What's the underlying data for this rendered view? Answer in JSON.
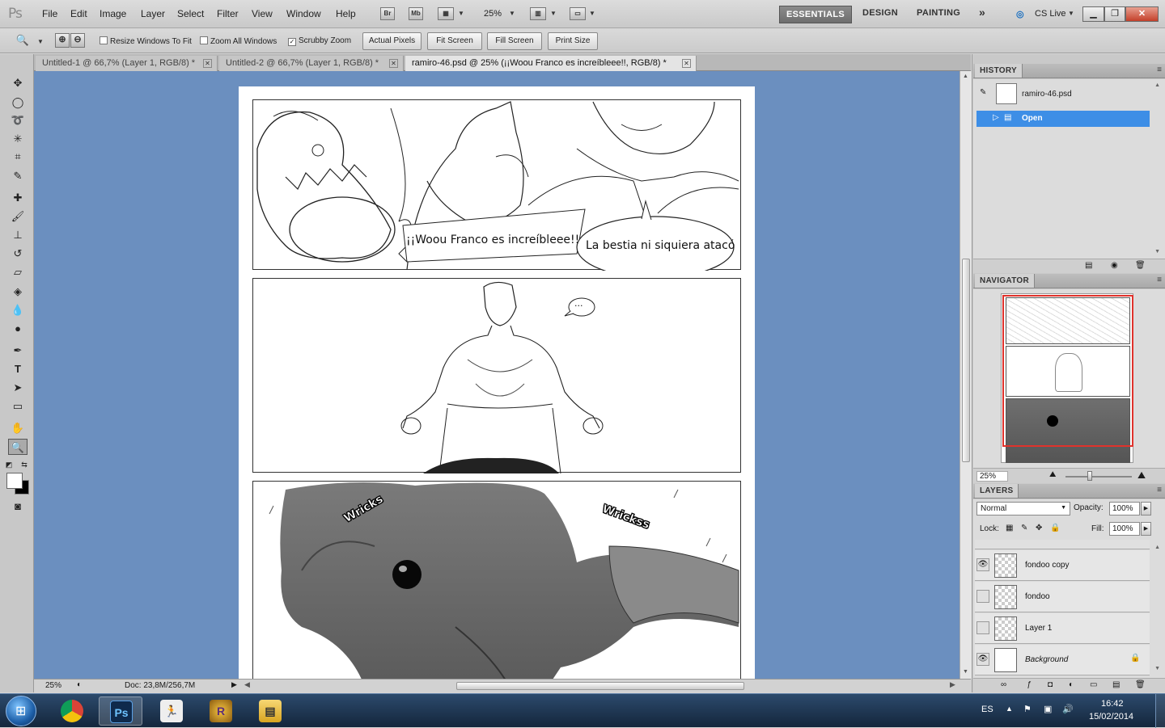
{
  "app": {
    "logo": "Ps"
  },
  "menu": [
    "File",
    "Edit",
    "Image",
    "Layer",
    "Select",
    "Filter",
    "View",
    "Window",
    "Help"
  ],
  "appbar": {
    "bridge": "Br",
    "minibridge": "Mb",
    "zoom": "25%"
  },
  "workspaces": {
    "essentials": "ESSENTIALS",
    "design": "DESIGN",
    "painting": "PAINTING",
    "more": "»",
    "cslive": "CS Live"
  },
  "options": {
    "resize": "Resize Windows To Fit",
    "zoom_all": "Zoom All Windows",
    "scrubby": "Scrubby Zoom",
    "scrubby_checked": "✓",
    "actual": "Actual Pixels",
    "fit": "Fit Screen",
    "fill": "Fill Screen",
    "print": "Print Size"
  },
  "tabs": [
    {
      "label": "Untitled-1 @ 66,7% (Layer 1, RGB/8) *"
    },
    {
      "label": "Untitled-2 @ 66,7% (Layer 1, RGB/8) *"
    },
    {
      "label": "ramiro-46.psd @ 25% (¡¡Woou Franco es increíbleee!!, RGB/8) *"
    }
  ],
  "comic": {
    "bubble1": "¡¡Woou Franco es increíbleee!!",
    "bubble2": "La bestia ni siquiera atacó",
    "thought": "...",
    "sfx1": "Wricks",
    "sfx2": "Wrickss"
  },
  "status": {
    "zoom": "25%",
    "doc": "Doc: 23,8M/256,7M"
  },
  "history": {
    "title": "HISTORY",
    "snapshot": "ramiro-46.psd",
    "step": "Open"
  },
  "navigator": {
    "title": "NAVIGATOR",
    "zoom": "25%"
  },
  "layers": {
    "title": "LAYERS",
    "blend": "Normal",
    "opacity_label": "Opacity:",
    "opacity": "100%",
    "lock_label": "Lock:",
    "fill_label": "Fill:",
    "fill": "100%",
    "items": [
      {
        "name": "fondoo copy",
        "visible": "👁"
      },
      {
        "name": "fondoo",
        "visible": ""
      },
      {
        "name": "Layer 1",
        "visible": ""
      },
      {
        "name": "Background",
        "visible": "👁"
      }
    ]
  },
  "taskbar": {
    "lang": "ES",
    "time": "16:42",
    "date": "15/02/2014"
  }
}
